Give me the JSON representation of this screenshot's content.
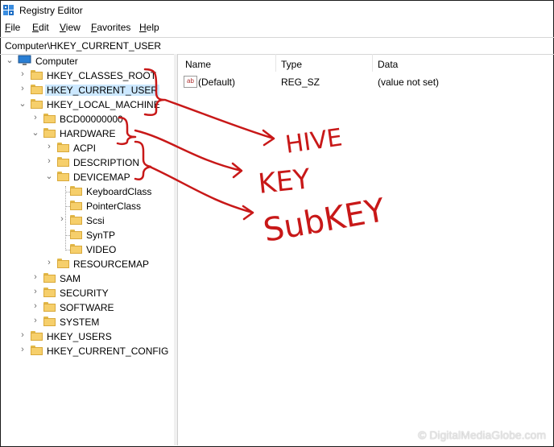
{
  "window": {
    "title": "Registry Editor"
  },
  "menu": [
    {
      "key": "F",
      "rest": "ile"
    },
    {
      "key": "E",
      "rest": "dit"
    },
    {
      "key": "V",
      "rest": "iew"
    },
    {
      "key": "F",
      "rest": "avorites"
    },
    {
      "key": "H",
      "rest": "elp"
    }
  ],
  "address": "Computer\\HKEY_CURRENT_USER",
  "tree": {
    "root": "Computer",
    "hkcr": "HKEY_CLASSES_ROOT",
    "hkcu": "HKEY_CURRENT_USER",
    "hklm": "HKEY_LOCAL_MACHINE",
    "bcd": "BCD00000000",
    "hardware": "HARDWARE",
    "acpi": "ACPI",
    "description": "DESCRIPTION",
    "devicemap": "DEVICEMAP",
    "keyboardclass": "KeyboardClass",
    "pointerclass": "PointerClass",
    "scsi": "Scsi",
    "syntp": "SynTP",
    "video": "VIDEO",
    "resourcemap": "RESOURCEMAP",
    "sam": "SAM",
    "security": "SECURITY",
    "software": "SOFTWARE",
    "system": "SYSTEM",
    "hku": "HKEY_USERS",
    "hkcc": "HKEY_CURRENT_CONFIG"
  },
  "columns": {
    "name": "Name",
    "type": "Type",
    "data": "Data"
  },
  "values": [
    {
      "icon": "ab",
      "name": "(Default)",
      "type": "REG_SZ",
      "data": "(value not set)"
    }
  ],
  "annotations": {
    "hive": "HIVE",
    "key": "KEY",
    "subkey": "SubKEY",
    "color": "#c81818"
  },
  "watermark": "© DigitalMediaGlobe.com",
  "colors": {
    "selection": "#cce8ff",
    "folder": "#f6cf6b",
    "accent": "#0078d7"
  }
}
